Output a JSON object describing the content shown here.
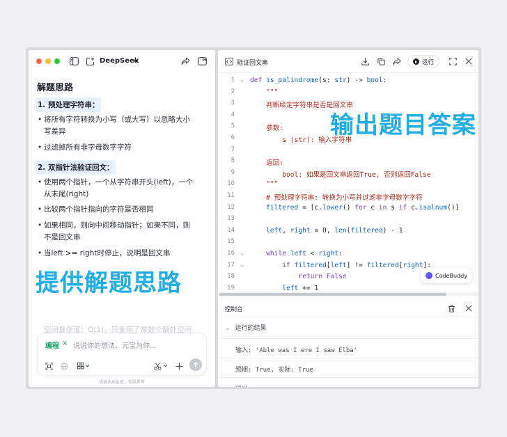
{
  "chat": {
    "model": "DeepSeek",
    "title": "解题思路",
    "sections": [
      {
        "heading": "1. 预处理字符串：",
        "bullets": [
          "将所有字符转换为小写（或大写）以忽略大小写差异",
          "过滤掉所有非字母数字字符"
        ]
      },
      {
        "heading": "2. 双指针法验证回文：",
        "bullets": [
          "使用两个指针，一个从字符串开头(left)，一个从末尾(right)",
          "比较两个指针指向的字符是否相同",
          "如果相同，则向中间移动指针；如果不同，则不是回文串",
          "当left >= right时停止，说明是回文串"
        ]
      }
    ],
    "overlay": "提供解题思路",
    "faded_line": "空间复杂度：O(1)，只使用了常数个额外空间",
    "composer": {
      "tag": "编程",
      "tag_close": "×",
      "placeholder": "说说你的想法、元宝为你..."
    },
    "disclaimer": "内容由AI生成，仅供参考"
  },
  "editor": {
    "title": "验证回文串",
    "run_label": "运行",
    "overlay": "输出题目答案",
    "badge": "CodeBuddy"
  },
  "console": {
    "title": "控制台",
    "section": "运行的结果",
    "rows": [
      "输入: 'Able was I ere I saw Elba'",
      "预期: True, 实际: True",
      "通过"
    ]
  }
}
